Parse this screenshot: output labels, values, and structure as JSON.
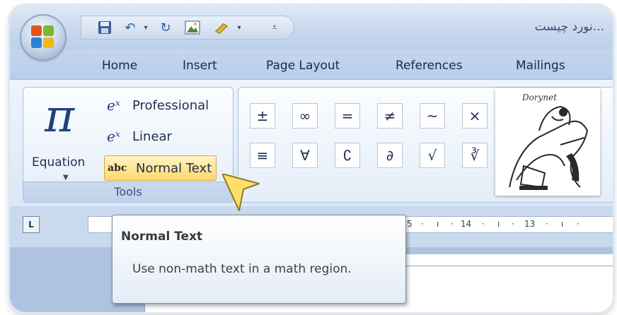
{
  "window": {
    "doc_title": "...نورد چیست"
  },
  "office_button": {
    "icon": "office-logo-icon"
  },
  "quick_access": {
    "items": [
      "save-icon",
      "undo-icon",
      "dropdown-arrow-icon",
      "redo-icon",
      "picture-icon",
      "customize-icon",
      "dropdown-arrow-icon",
      "qat-customize-arrow-icon"
    ]
  },
  "tabs": [
    "Home",
    "Insert",
    "Page Layout",
    "References",
    "Mailings"
  ],
  "tools_group": {
    "equation_label": "Equation",
    "options": [
      {
        "label": "Professional",
        "icon": "professional-icon"
      },
      {
        "label": "Linear",
        "icon": "linear-icon"
      },
      {
        "label": "Normal Text",
        "icon_text": "abc"
      }
    ],
    "group_label": "Tools"
  },
  "symbols": {
    "row1": [
      "±",
      "∞",
      "=",
      "≠",
      "~",
      "×"
    ],
    "row2": [
      "≡",
      "∀",
      "∁",
      "∂",
      "√",
      "∛"
    ]
  },
  "logo": {
    "text": "Dorynet"
  },
  "ruler": {
    "marks": [
      "5",
      "14",
      "13"
    ]
  },
  "tooltip": {
    "title": "Normal Text",
    "description": "Use non-math text in a math region."
  }
}
